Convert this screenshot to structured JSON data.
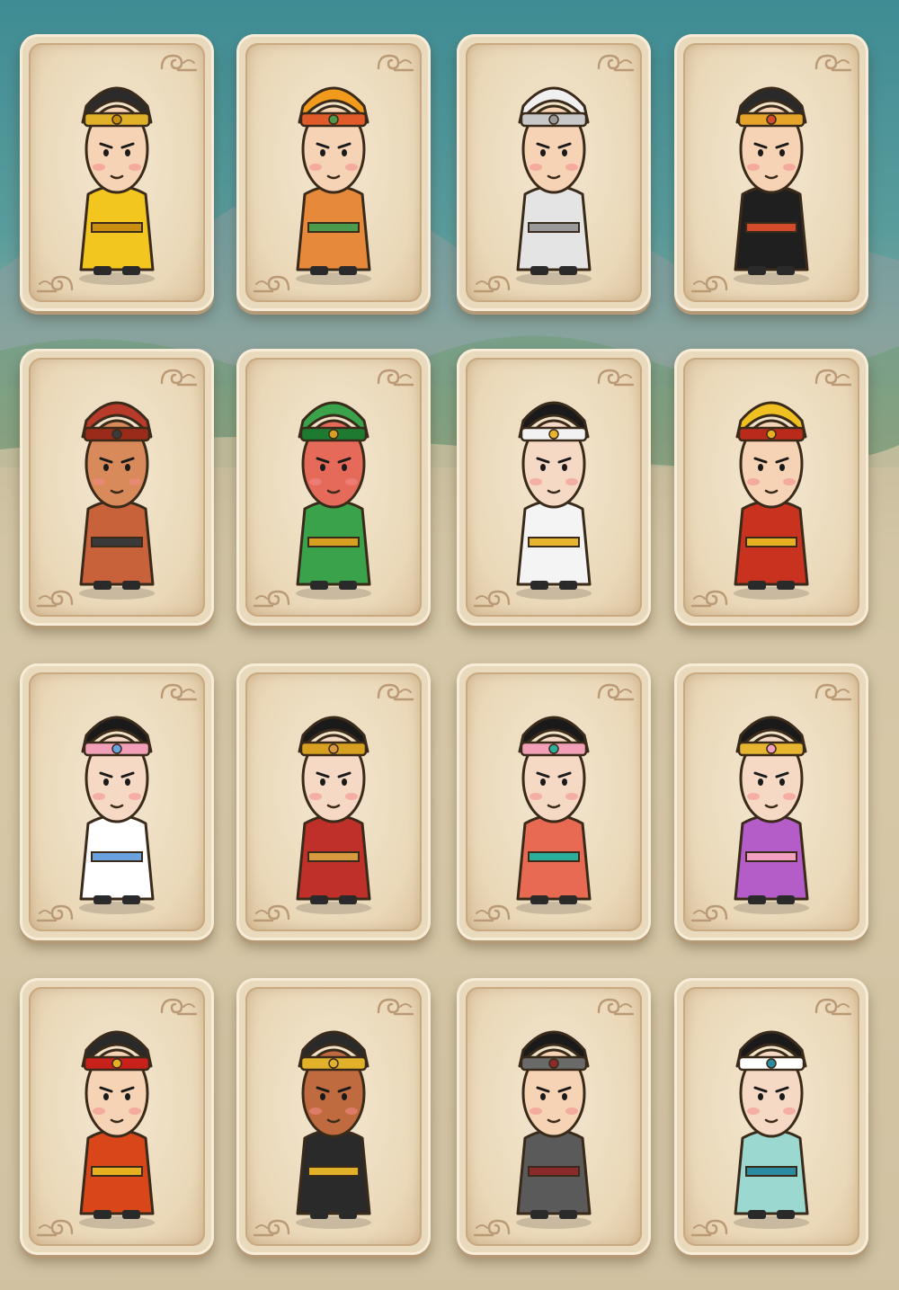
{
  "colors": {
    "sky": "#3f8c94",
    "ground": "#d7c9a9",
    "card_face": "#e9d9bd",
    "card_border": "#c9a97f"
  },
  "cards": [
    {
      "icon": "emperor-guard-icon",
      "hat": "#2b2b2b",
      "band": "#e2b12a",
      "robe": "#f2c61f",
      "skin": "#f6d3b4",
      "accent": "#c98d10"
    },
    {
      "icon": "tiger-hood-icon",
      "hat": "#f29a1c",
      "band": "#e05a2a",
      "robe": "#e6893a",
      "skin": "#f6d3b4",
      "accent": "#4c9a4c"
    },
    {
      "icon": "chef-hat-icon",
      "hat": "#f0f0f0",
      "band": "#c8c8c8",
      "robe": "#e4e4e4",
      "skin": "#f6d3b4",
      "accent": "#9a9a9a"
    },
    {
      "icon": "official-crown-icon",
      "hat": "#2a2a2a",
      "band": "#e6a52a",
      "robe": "#1f1f1f",
      "skin": "#f6d3b4",
      "accent": "#d34b2a"
    },
    {
      "icon": "bearded-warrior-icon",
      "hat": "#b73a2a",
      "band": "#9a2a1a",
      "robe": "#c8623a",
      "skin": "#d98a5a",
      "accent": "#3a3a3a"
    },
    {
      "icon": "green-general-icon",
      "hat": "#3aa24a",
      "band": "#1e7a30",
      "robe": "#3aa24a",
      "skin": "#e66a5a",
      "accent": "#d8a020"
    },
    {
      "icon": "white-robe-lady-icon",
      "hat": "#1a1a1a",
      "band": "#f2f2f2",
      "robe": "#f4f4f4",
      "skin": "#f6d9c4",
      "accent": "#e8b530"
    },
    {
      "icon": "monk-staff-icon",
      "hat": "#f0c020",
      "band": "#b92a1a",
      "robe": "#c8321e",
      "skin": "#f6d3b4",
      "accent": "#e6b020"
    },
    {
      "icon": "maiden-basket-icon",
      "hat": "#1a1a1a",
      "band": "#f2a0b8",
      "robe": "#ffffff",
      "skin": "#f6d9c4",
      "accent": "#6aa2e0"
    },
    {
      "icon": "pipa-lady-icon",
      "hat": "#1a1a1a",
      "band": "#d8a020",
      "robe": "#c0302a",
      "skin": "#f6d9c4",
      "accent": "#d89a40"
    },
    {
      "icon": "lotus-lady-icon",
      "hat": "#1a1a1a",
      "band": "#f2a0b8",
      "robe": "#e86a52",
      "skin": "#f6d9c4",
      "accent": "#2ab09a"
    },
    {
      "icon": "purple-lady-icon",
      "hat": "#1a1a1a",
      "band": "#e8b530",
      "robe": "#b45cc8",
      "skin": "#f6d9c4",
      "accent": "#f2a0c0"
    },
    {
      "icon": "red-scholar-icon",
      "hat": "#2a2a2a",
      "band": "#c8201a",
      "robe": "#d8461a",
      "skin": "#f6d3b4",
      "accent": "#e6b020"
    },
    {
      "icon": "judge-bao-icon",
      "hat": "#2a2a2a",
      "band": "#e2b12a",
      "robe": "#2a2a2a",
      "skin": "#c06a40",
      "accent": "#e2b12a"
    },
    {
      "icon": "swordsman-icon",
      "hat": "#1a1a1a",
      "band": "#6a6a6a",
      "robe": "#5a5a5a",
      "skin": "#f6d3b4",
      "accent": "#8a2a2a"
    },
    {
      "icon": "teal-maiden-icon",
      "hat": "#1a1a1a",
      "band": "#ffffff",
      "robe": "#9ad8d0",
      "skin": "#f6d9c4",
      "accent": "#2a8aa0"
    }
  ]
}
